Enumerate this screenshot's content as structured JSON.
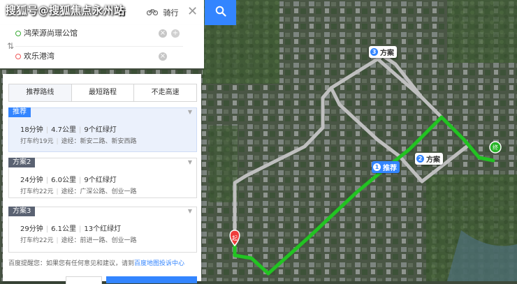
{
  "watermark": "搜狐号@搜狐焦点永州站",
  "topbar": {
    "mode_partial": "行",
    "ride_label": "骑行",
    "ride_icon": "bicycle-icon",
    "close_icon": "close-icon",
    "search_icon": "search-icon"
  },
  "route_inputs": {
    "start": "鸿荣源尚璟公馆",
    "end": "欢乐港湾",
    "swap_icon": "swap-icon"
  },
  "tabs": [
    "推荐路线",
    "最短路程",
    "不走高速"
  ],
  "plans": [
    {
      "badge": "推荐",
      "time": "18分钟",
      "distance": "4.7公里",
      "lights": "9个红绿灯",
      "taxi": "打车约19元",
      "via": "途经：新安二路、新安西路"
    },
    {
      "badge": "方案2",
      "time": "24分钟",
      "distance": "6.0公里",
      "lights": "9个红绿灯",
      "taxi": "打车约22元",
      "via": "途经：广深公路、创业一路"
    },
    {
      "badge": "方案3",
      "time": "29分钟",
      "distance": "6.1公里",
      "lights": "13个红绿灯",
      "taxi": "打车约22元",
      "via": "途经：前进一路、创业一路"
    }
  ],
  "tip": {
    "text": "百度提醒您：如果您有任何意见和建议，请到",
    "link": "百度地图投诉中心"
  },
  "map_labels": {
    "recommended": {
      "num": "1",
      "text": "推荐"
    },
    "plan2": {
      "num": "2",
      "text": "方案"
    },
    "plan3": {
      "num": "3",
      "text": "方案"
    },
    "start_marker": "起",
    "end_marker": "终"
  },
  "colors": {
    "recommended_route": "#22c322",
    "alt_route": "#bfbfbf",
    "accent": "#3385ff"
  }
}
